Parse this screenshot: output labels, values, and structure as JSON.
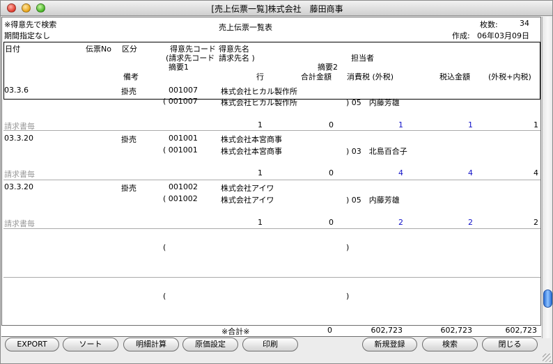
{
  "window": {
    "title": "[売上伝票一覧]株式会社　藤田商事"
  },
  "info": {
    "search_mode": "※得意先で検索",
    "period": "期間指定なし",
    "report_title": "売上伝票一覧表",
    "count_label": "枚数:",
    "count_value": "34",
    "created_label": "作成:",
    "created_date": "06年03月09日"
  },
  "headers": {
    "date": "日付",
    "voucher_no": "伝票No",
    "category": "区分",
    "customer_code": "得意先コード",
    "billing_code": "(請求先コード",
    "summary1": "摘要1",
    "remarks": "備考",
    "customer_name": "得意先名",
    "billing_name": "請求先名 )",
    "line": "行",
    "summary2": "摘要2",
    "total": "合計金額",
    "person": "担当者",
    "tax_ex": "消費税 (外税)",
    "tax_incl": "税込金額",
    "tax_sum": "(外税+内税)"
  },
  "rows": [
    {
      "date": "03.3.6",
      "category": "掛売",
      "customer_code": "001007",
      "billing_code": "( 001007",
      "customer_name": "株式会社ヒカル製作所",
      "billing_name": "株式会社ヒカル製作所",
      "person": ") 05　内藤芳雄",
      "remarks": "請求書毎",
      "line": "1",
      "total": "0",
      "tax_ex": "1",
      "tax_incl": "1",
      "tax_sum": "1"
    },
    {
      "date": "03.3.20",
      "category": "掛売",
      "customer_code": "001001",
      "billing_code": "( 001001",
      "customer_name": "株式会社本宮商事",
      "billing_name": "株式会社本宮商事",
      "person": ") 03　北島百合子",
      "remarks": "請求書毎",
      "line": "1",
      "total": "0",
      "tax_ex": "4",
      "tax_incl": "4",
      "tax_sum": "4"
    },
    {
      "date": "03.3.20",
      "category": "掛売",
      "customer_code": "001002",
      "billing_code": "( 001002",
      "customer_name": "株式会社アイワ",
      "billing_name": "株式会社アイワ",
      "person": ") 05　内藤芳雄",
      "remarks": "請求書毎",
      "line": "1",
      "total": "0",
      "tax_ex": "2",
      "tax_incl": "2",
      "tax_sum": "2"
    }
  ],
  "empty_rows": [
    {
      "open_paren": "(",
      "close_paren": ")"
    },
    {
      "open_paren": "(",
      "close_paren": ")"
    }
  ],
  "footer": {
    "label": "※合計※",
    "total": "0",
    "tax_ex": "602,723",
    "tax_incl": "602,723",
    "tax_sum": "602,723"
  },
  "buttons": {
    "export": "EXPORT",
    "sort": "ソート",
    "detail_calc": "明細計算",
    "cost_setting": "原価設定",
    "print": "印刷",
    "new_entry": "新規登録",
    "search": "検索",
    "close": "閉じる"
  },
  "colors": {
    "blue_value": "#1010c8",
    "muted_text": "#9a9a9a"
  }
}
